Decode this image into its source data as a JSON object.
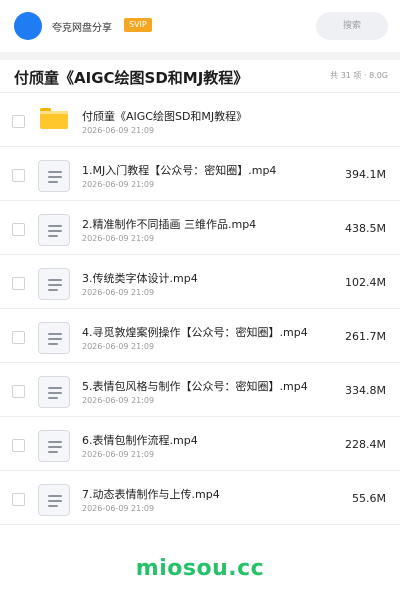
{
  "header": {
    "app_name": "夸克网盘分享",
    "badge": "SVIP",
    "search_label": "搜索"
  },
  "folder": {
    "title": "付颀童《AIGC绘图SD和MJ教程》",
    "meta": "共 31 项 · 8.0G"
  },
  "items": [
    {
      "name": "付颀童《AIGC绘图SD和MJ教程》",
      "date": "2026-06-09 21:09",
      "size": "",
      "type": "folder-icon"
    },
    {
      "name": "1.MJ入门教程【公众号：密知圈】.mp4",
      "date": "2026-06-09 21:09",
      "size": "394.1M",
      "type": "file-icon"
    },
    {
      "name": "2.精准制作不同插画 三维作品.mp4",
      "date": "2026-06-09 21:09",
      "size": "438.5M",
      "type": "file-icon"
    },
    {
      "name": "3.传统类字体设计.mp4",
      "date": "2026-06-09 21:09",
      "size": "102.4M",
      "type": "file-icon"
    },
    {
      "name": "4.寻觅敦煌案例操作【公众号：密知圈】.mp4",
      "date": "2026-06-09 21:09",
      "size": "261.7M",
      "type": "file-icon"
    },
    {
      "name": "5.表情包风格与制作【公众号：密知圈】.mp4",
      "date": "2026-06-09 21:09",
      "size": "334.8M",
      "type": "file-icon"
    },
    {
      "name": "6.表情包制作流程.mp4",
      "date": "2026-06-09 21:09",
      "size": "228.4M",
      "type": "file-icon"
    },
    {
      "name": "7.动态表情制作与上传.mp4",
      "date": "2026-06-09 21:09",
      "size": "55.6M",
      "type": "file-icon"
    }
  ],
  "watermark": "miosou.cc",
  "colors": {
    "accent": "#1f7cf2",
    "svip": "#f5a623",
    "folder": "#ffc72c",
    "watermark": "#25c26a"
  }
}
